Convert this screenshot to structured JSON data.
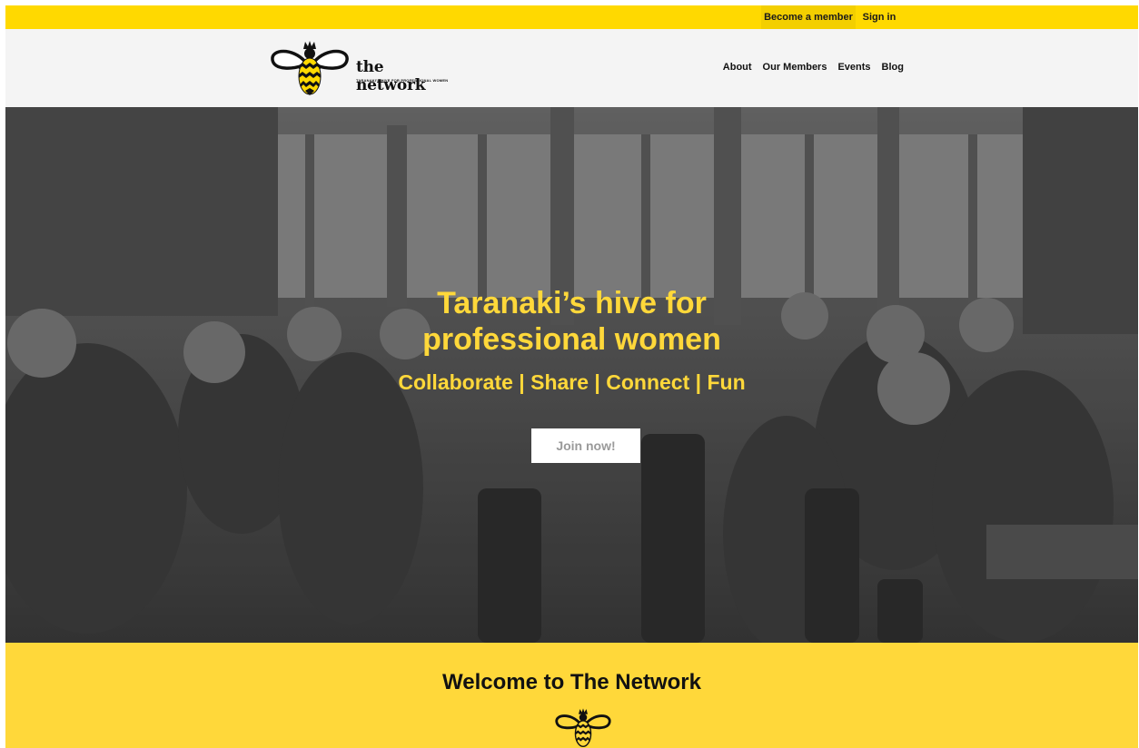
{
  "topbar": {
    "become_member": "Become a member",
    "sign_in": "Sign in"
  },
  "header": {
    "brand": "the network",
    "tagline": "TARANAKI'S HIVE FOR PROFESSIONAL WOMEN",
    "logo_icon": "bee-icon",
    "nav": {
      "about": "About",
      "members": "Our Members",
      "events": "Events",
      "blog": "Blog"
    }
  },
  "hero": {
    "title_line1": "Taranaki’s hive for",
    "title_line2": "professional women",
    "subtitle": "Collaborate | Share | Connect | Fun",
    "cta": "Join now!"
  },
  "welcome": {
    "heading": "Welcome to The Network",
    "icon": "bee-icon"
  },
  "colors": {
    "accent_yellow": "#ffd900",
    "hero_text": "#ffd83a",
    "welcome_bg": "#ffd83a"
  }
}
